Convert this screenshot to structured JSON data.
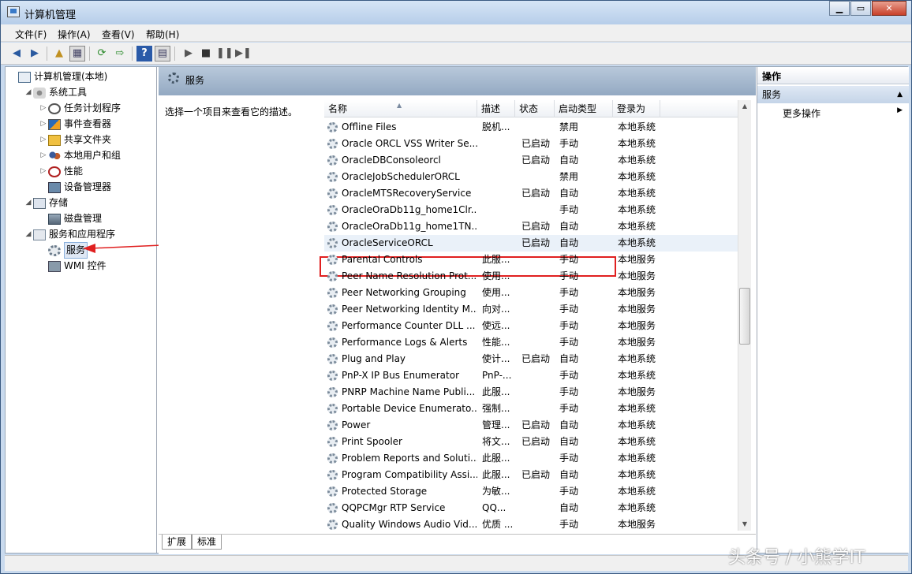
{
  "window": {
    "title": "计算机管理",
    "min": "0",
    "max": "1",
    "close": "r"
  },
  "menu": [
    "文件(F)",
    "操作(A)",
    "查看(V)",
    "帮助(H)"
  ],
  "tree": [
    {
      "label": "计算机管理(本地)",
      "icon": "computer-management-icon",
      "depth": 0,
      "toggle": ""
    },
    {
      "label": "系统工具",
      "icon": "system-tools-icon",
      "depth": 1,
      "toggle": "◢"
    },
    {
      "label": "任务计划程序",
      "icon": "task-scheduler-icon",
      "depth": 2,
      "toggle": "▷"
    },
    {
      "label": "事件查看器",
      "icon": "event-viewer-icon",
      "depth": 2,
      "toggle": "▷"
    },
    {
      "label": "共享文件夹",
      "icon": "shared-folders-icon",
      "depth": 2,
      "toggle": "▷"
    },
    {
      "label": "本地用户和组",
      "icon": "local-users-icon",
      "depth": 2,
      "toggle": "▷"
    },
    {
      "label": "性能",
      "icon": "performance-icon",
      "depth": 2,
      "toggle": "▷"
    },
    {
      "label": "设备管理器",
      "icon": "device-manager-icon",
      "depth": 2,
      "toggle": ""
    },
    {
      "label": "存储",
      "icon": "storage-icon",
      "depth": 1,
      "toggle": "◢"
    },
    {
      "label": "磁盘管理",
      "icon": "disk-management-icon",
      "depth": 2,
      "toggle": ""
    },
    {
      "label": "服务和应用程序",
      "icon": "services-apps-icon",
      "depth": 1,
      "toggle": "◢"
    },
    {
      "label": "服务",
      "icon": "services-gear-icon",
      "depth": 2,
      "toggle": "",
      "selected": true
    },
    {
      "label": "WMI 控件",
      "icon": "wmi-control-icon",
      "depth": 2,
      "toggle": ""
    }
  ],
  "middle": {
    "header": "服务",
    "description": "选择一个项目来查看它的描述。",
    "columns": [
      "名称",
      "描述",
      "状态",
      "启动类型",
      "登录为"
    ],
    "services": [
      {
        "name": "Offline Files",
        "desc": "脱机...",
        "status": "",
        "startup": "禁用",
        "logon": "本地系统"
      },
      {
        "name": "Oracle ORCL VSS Writer Se...",
        "desc": "",
        "status": "已启动",
        "startup": "手动",
        "logon": "本地系统"
      },
      {
        "name": "OracleDBConsoleorcl",
        "desc": "",
        "status": "已启动",
        "startup": "自动",
        "logon": "本地系统"
      },
      {
        "name": "OracleJobSchedulerORCL",
        "desc": "",
        "status": "",
        "startup": "禁用",
        "logon": "本地系统"
      },
      {
        "name": "OracleMTSRecoveryService",
        "desc": "",
        "status": "已启动",
        "startup": "自动",
        "logon": "本地系统"
      },
      {
        "name": "OracleOraDb11g_home1Clr...",
        "desc": "",
        "status": "",
        "startup": "手动",
        "logon": "本地系统"
      },
      {
        "name": "OracleOraDb11g_home1TN...",
        "desc": "",
        "status": "已启动",
        "startup": "自动",
        "logon": "本地系统"
      },
      {
        "name": "OracleServiceORCL",
        "desc": "",
        "status": "已启动",
        "startup": "自动",
        "logon": "本地系统",
        "highlight": true
      },
      {
        "name": "Parental Controls",
        "desc": "此服...",
        "status": "",
        "startup": "手动",
        "logon": "本地服务"
      },
      {
        "name": "Peer Name Resolution Prot...",
        "desc": "使用...",
        "status": "",
        "startup": "手动",
        "logon": "本地服务"
      },
      {
        "name": "Peer Networking Grouping",
        "desc": "使用...",
        "status": "",
        "startup": "手动",
        "logon": "本地服务"
      },
      {
        "name": "Peer Networking Identity M...",
        "desc": "向对...",
        "status": "",
        "startup": "手动",
        "logon": "本地服务"
      },
      {
        "name": "Performance Counter DLL ...",
        "desc": "使远...",
        "status": "",
        "startup": "手动",
        "logon": "本地服务"
      },
      {
        "name": "Performance Logs & Alerts",
        "desc": "性能...",
        "status": "",
        "startup": "手动",
        "logon": "本地服务"
      },
      {
        "name": "Plug and Play",
        "desc": "使计...",
        "status": "已启动",
        "startup": "自动",
        "logon": "本地系统"
      },
      {
        "name": "PnP-X IP Bus Enumerator",
        "desc": "PnP-...",
        "status": "",
        "startup": "手动",
        "logon": "本地系统"
      },
      {
        "name": "PNRP Machine Name Publi...",
        "desc": "此服...",
        "status": "",
        "startup": "手动",
        "logon": "本地服务"
      },
      {
        "name": "Portable Device Enumerato...",
        "desc": "强制...",
        "status": "",
        "startup": "手动",
        "logon": "本地系统"
      },
      {
        "name": "Power",
        "desc": "管理...",
        "status": "已启动",
        "startup": "自动",
        "logon": "本地系统"
      },
      {
        "name": "Print Spooler",
        "desc": "将文...",
        "status": "已启动",
        "startup": "自动",
        "logon": "本地系统"
      },
      {
        "name": "Problem Reports and Soluti...",
        "desc": "此服...",
        "status": "",
        "startup": "手动",
        "logon": "本地系统"
      },
      {
        "name": "Program Compatibility Assi...",
        "desc": "此服...",
        "status": "已启动",
        "startup": "自动",
        "logon": "本地系统"
      },
      {
        "name": "Protected Storage",
        "desc": "为敏...",
        "status": "",
        "startup": "手动",
        "logon": "本地系统"
      },
      {
        "name": "QQPCMgr RTP Service",
        "desc": "QQ...",
        "status": "",
        "startup": "自动",
        "logon": "本地系统"
      },
      {
        "name": "Quality Windows Audio Vid...",
        "desc": "优质 ...",
        "status": "",
        "startup": "手动",
        "logon": "本地服务"
      }
    ],
    "tabs": [
      "扩展",
      "标准"
    ]
  },
  "actions": {
    "header": "操作",
    "section": "服务",
    "item": "更多操作"
  },
  "watermark": "头条号 / 小熊学IT",
  "colors": {
    "highlight_border": "#e02020",
    "arrow": "#e02020"
  }
}
